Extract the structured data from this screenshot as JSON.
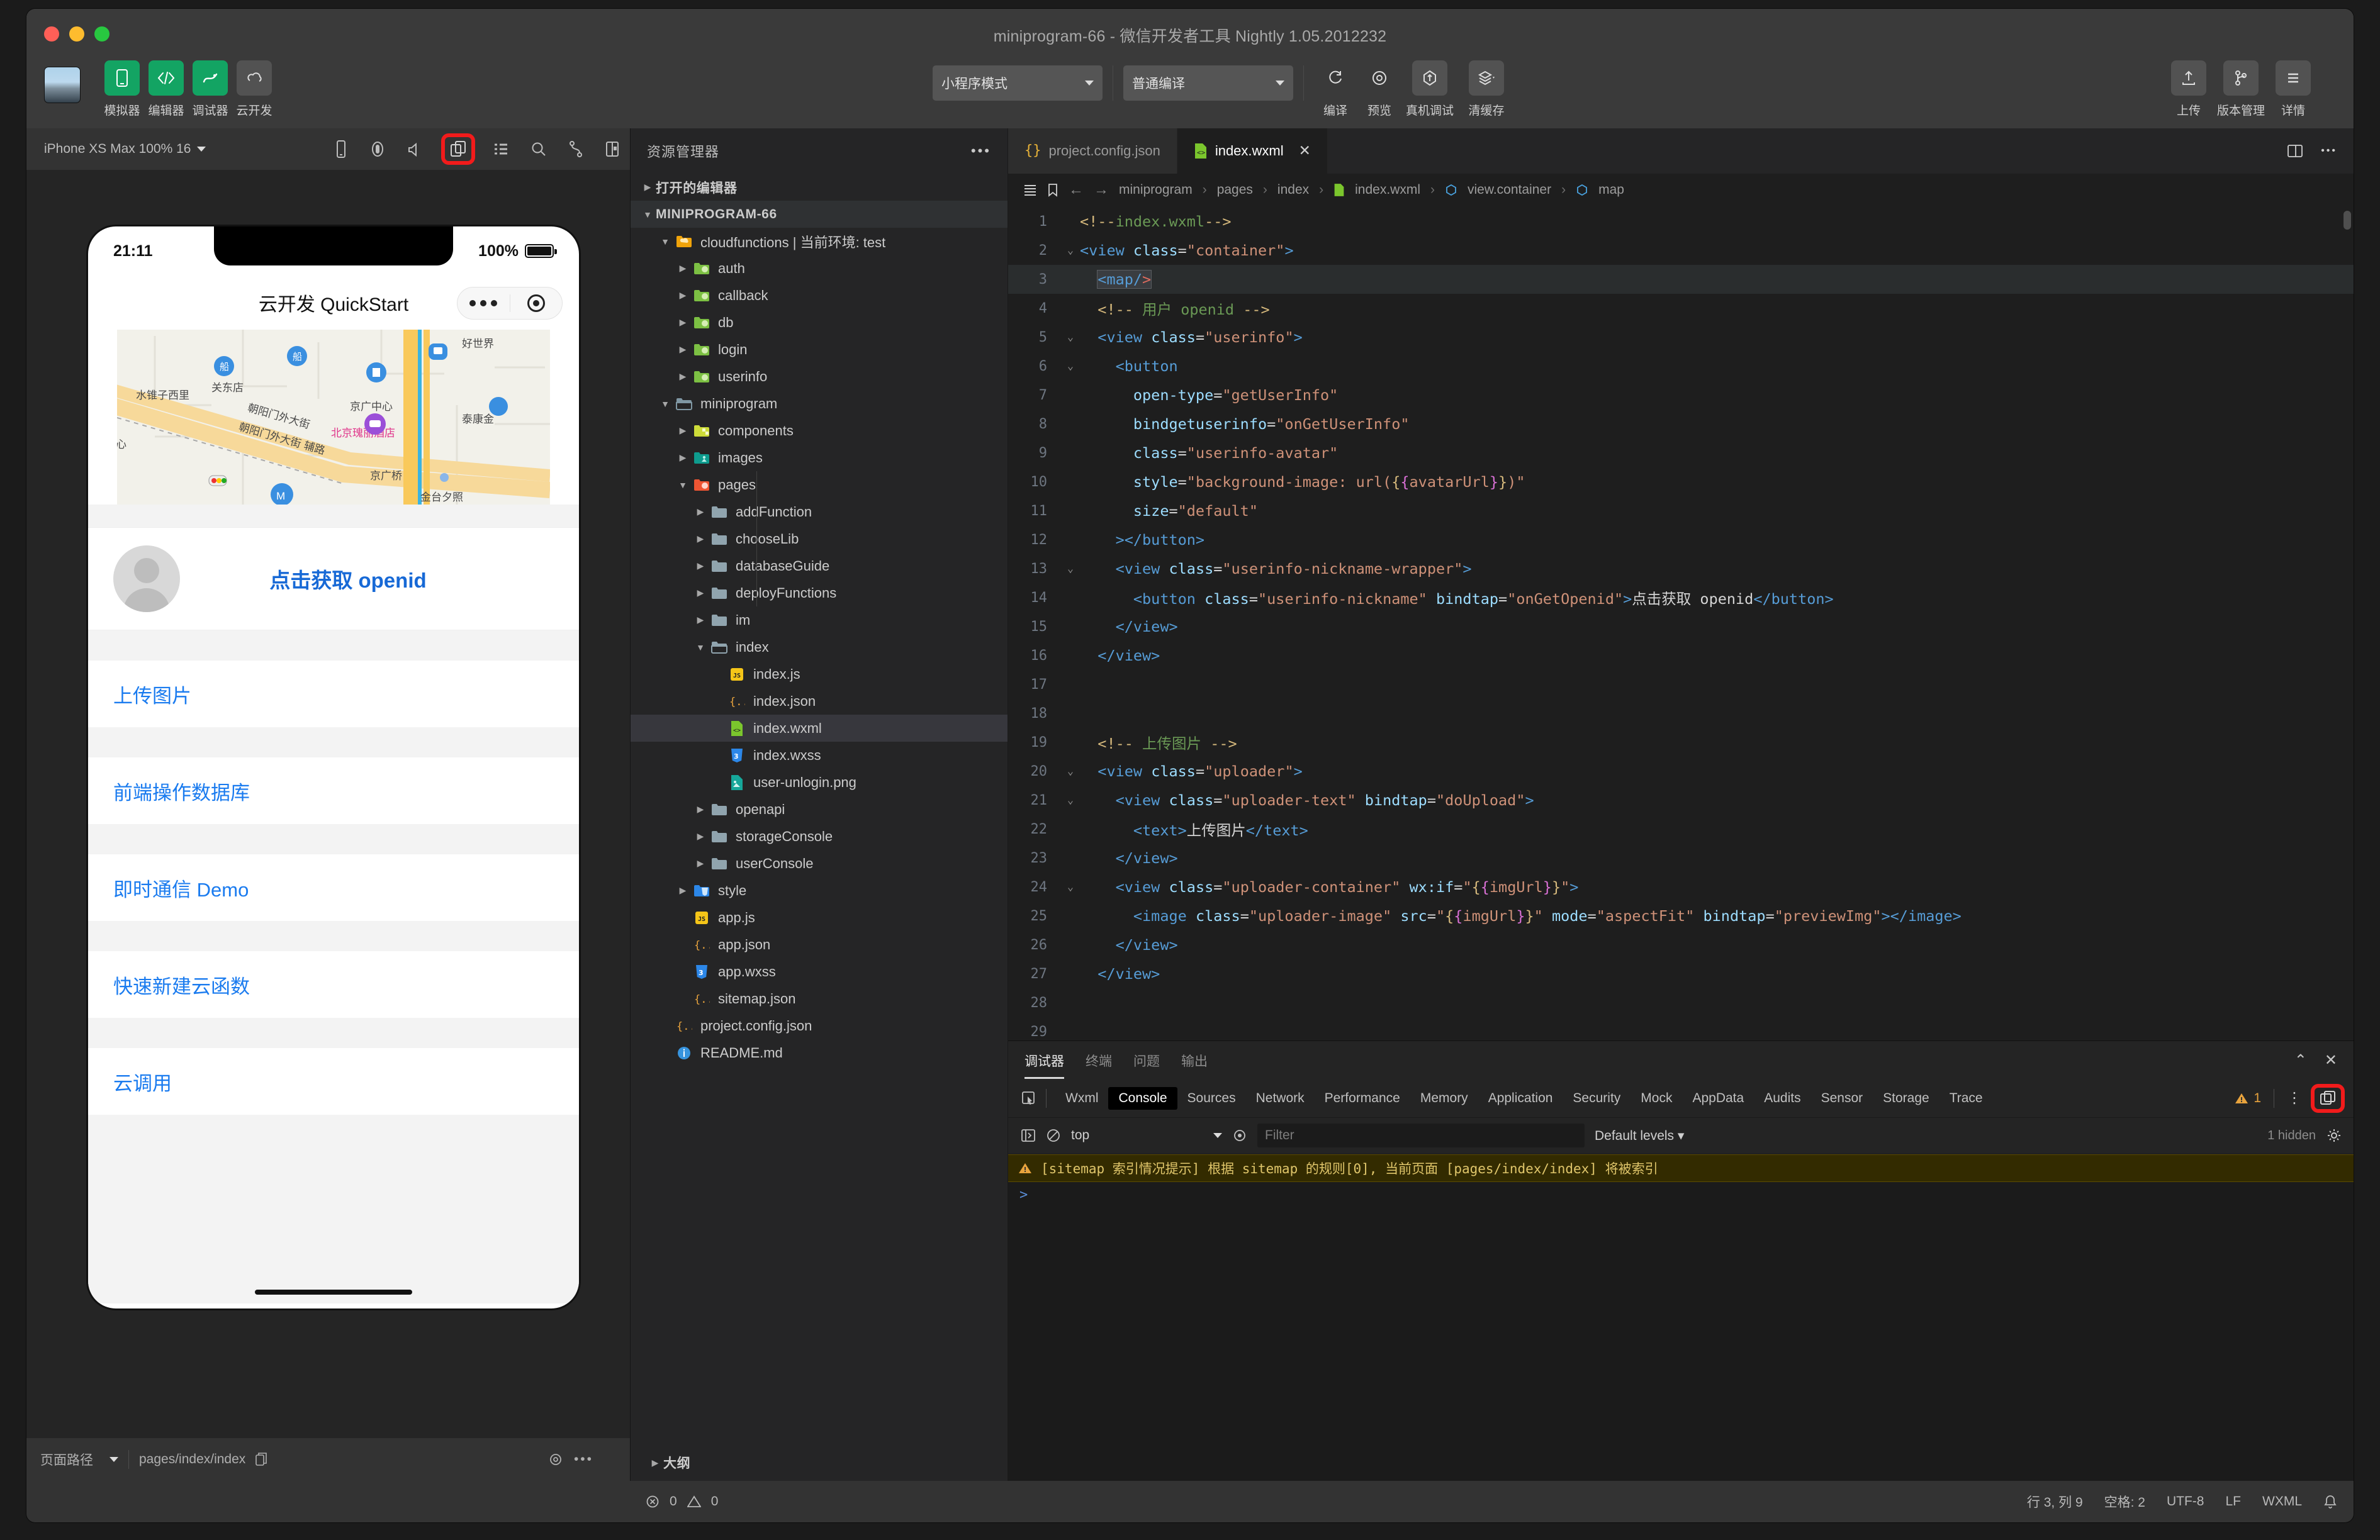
{
  "window": {
    "title": "miniprogram-66 - 微信开发者工具 Nightly 1.05.2012232"
  },
  "toolbar": {
    "items": [
      {
        "label": "模拟器",
        "icon": "phone-icon"
      },
      {
        "label": "编辑器",
        "icon": "code-icon"
      },
      {
        "label": "调试器",
        "icon": "bug-icon"
      },
      {
        "label": "云开发",
        "icon": "cloud-icon"
      }
    ],
    "mode_select": "小程序模式",
    "compile_select": "普通编译",
    "actions": [
      {
        "label": "编译",
        "icon": "refresh-icon"
      },
      {
        "label": "预览",
        "icon": "eye-icon"
      },
      {
        "label": "真机调试",
        "icon": "device-debug-icon"
      },
      {
        "label": "清缓存",
        "icon": "layers-icon"
      }
    ],
    "right_actions": [
      {
        "label": "上传",
        "icon": "upload-icon"
      },
      {
        "label": "版本管理",
        "icon": "branch-icon"
      },
      {
        "label": "详情",
        "icon": "list-icon"
      }
    ]
  },
  "simulator": {
    "device_label": "iPhone XS Max 100% 16",
    "toolbar_icons": [
      "phone-rotate-icon",
      "record-icon",
      "volume-icon",
      "multi-window-icon",
      "list-icon",
      "search-icon",
      "route-icon",
      "split-view-icon"
    ],
    "highlighted_icon_index": 3,
    "right_icon": "collapse-panel-icon",
    "phone": {
      "time": "21:11",
      "battery": "100%",
      "nav_title": "云开发 QuickStart",
      "map_labels": [
        "关东店",
        "水锥子西里",
        "京广中心",
        "朝阳门外大街",
        "朝阳门外大街 辅路",
        "北京瑰丽酒店",
        "泰康金",
        "京广桥",
        "好世界",
        "心",
        "金台夕照"
      ],
      "openid_button": "点击获取 openid",
      "cells": [
        "上传图片",
        "前端操作数据库",
        "即时通信 Demo",
        "快速新建云函数",
        "云调用"
      ]
    },
    "footer": {
      "page_path_label": "页面路径",
      "page_path": "pages/index/index"
    }
  },
  "explorer": {
    "title": "资源管理器",
    "more_icon": "ellipsis-icon",
    "open_editors": "打开的编辑器",
    "project": "MINIPROGRAM-66",
    "tree": [
      {
        "label": "cloudfunctions | 当前环境: test",
        "indent": 1,
        "kind": "folder-open-cloud",
        "arrow": "down"
      },
      {
        "label": "auth",
        "indent": 2,
        "kind": "folder-fn",
        "arrow": "right"
      },
      {
        "label": "callback",
        "indent": 2,
        "kind": "folder-fn",
        "arrow": "right"
      },
      {
        "label": "db",
        "indent": 2,
        "kind": "folder-fn",
        "arrow": "right"
      },
      {
        "label": "login",
        "indent": 2,
        "kind": "folder-fn",
        "arrow": "right"
      },
      {
        "label": "userinfo",
        "indent": 2,
        "kind": "folder-fn",
        "arrow": "right"
      },
      {
        "label": "miniprogram",
        "indent": 1,
        "kind": "folder-open",
        "arrow": "down"
      },
      {
        "label": "components",
        "indent": 2,
        "kind": "folder-comp",
        "arrow": "right"
      },
      {
        "label": "images",
        "indent": 2,
        "kind": "folder-img",
        "arrow": "right"
      },
      {
        "label": "pages",
        "indent": 2,
        "kind": "folder-pages",
        "arrow": "down"
      },
      {
        "label": "addFunction",
        "indent": 3,
        "kind": "folder",
        "arrow": "right"
      },
      {
        "label": "chooseLib",
        "indent": 3,
        "kind": "folder",
        "arrow": "right"
      },
      {
        "label": "databaseGuide",
        "indent": 3,
        "kind": "folder",
        "arrow": "right"
      },
      {
        "label": "deployFunctions",
        "indent": 3,
        "kind": "folder",
        "arrow": "right"
      },
      {
        "label": "im",
        "indent": 3,
        "kind": "folder",
        "arrow": "right"
      },
      {
        "label": "index",
        "indent": 3,
        "kind": "folder-open-plain",
        "arrow": "down"
      },
      {
        "label": "index.js",
        "indent": 4,
        "kind": "js",
        "arrow": "none"
      },
      {
        "label": "index.json",
        "indent": 4,
        "kind": "json",
        "arrow": "none"
      },
      {
        "label": "index.wxml",
        "indent": 4,
        "kind": "wxml",
        "arrow": "none",
        "selected": true
      },
      {
        "label": "index.wxss",
        "indent": 4,
        "kind": "wxss",
        "arrow": "none"
      },
      {
        "label": "user-unlogin.png",
        "indent": 4,
        "kind": "png",
        "arrow": "none"
      },
      {
        "label": "openapi",
        "indent": 3,
        "kind": "folder",
        "arrow": "right"
      },
      {
        "label": "storageConsole",
        "indent": 3,
        "kind": "folder",
        "arrow": "right"
      },
      {
        "label": "userConsole",
        "indent": 3,
        "kind": "folder",
        "arrow": "right"
      },
      {
        "label": "style",
        "indent": 2,
        "kind": "folder-style",
        "arrow": "right"
      },
      {
        "label": "app.js",
        "indent": 2,
        "kind": "js",
        "arrow": "none"
      },
      {
        "label": "app.json",
        "indent": 2,
        "kind": "json",
        "arrow": "none"
      },
      {
        "label": "app.wxss",
        "indent": 2,
        "kind": "wxss",
        "arrow": "none"
      },
      {
        "label": "sitemap.json",
        "indent": 2,
        "kind": "json",
        "arrow": "none"
      },
      {
        "label": "project.config.json",
        "indent": 1,
        "kind": "json",
        "arrow": "none"
      },
      {
        "label": "README.md",
        "indent": 1,
        "kind": "md",
        "arrow": "none"
      }
    ],
    "outline": "大纲",
    "problems": {
      "errors": "0",
      "warnings": "0"
    }
  },
  "editor": {
    "tabs": [
      {
        "label": "project.config.json",
        "icon": "json-icon",
        "active": false
      },
      {
        "label": "index.wxml",
        "icon": "wxml-icon",
        "active": true,
        "close": "✕"
      }
    ],
    "tab_actions": [
      "split-editor-icon",
      "ellipsis-icon"
    ],
    "breadcrumb": [
      "miniprogram",
      "pages",
      "index",
      "index.wxml",
      "view.container",
      "map"
    ],
    "breadcrumb_icons": [
      "outline-icon",
      "bookmark-icon",
      "arrow-left-icon",
      "arrow-right-icon"
    ],
    "lines": [
      {
        "n": "1",
        "fold": "",
        "html": "<span class='k-cmtp'>&lt;!--</span><span class='k-cmt'>index.wxml</span><span class='k-cmtp'>--&gt;</span>"
      },
      {
        "n": "2",
        "fold": "v",
        "html": "<span class='k-tag'>&lt;view</span> <span class='k-attr'>class</span><span class='k-txt'>=</span><span class='k-str'>\"container\"</span><span class='k-tag'>&gt;</span>"
      },
      {
        "n": "3",
        "fold": "",
        "hl": true,
        "html": "  <span class='selbox'><span class='k-tag'>&lt;map/</span><span class='k-red'>&gt;</span></span>"
      },
      {
        "n": "4",
        "fold": "",
        "html": "  <span class='k-cmtp'>&lt;!--</span> <span class='k-cmt'>用户 openid</span> <span class='k-cmtp'>--&gt;</span>"
      },
      {
        "n": "5",
        "fold": "v",
        "html": "  <span class='k-tag'>&lt;view</span> <span class='k-attr'>class</span><span class='k-txt'>=</span><span class='k-str'>\"userinfo\"</span><span class='k-tag'>&gt;</span>"
      },
      {
        "n": "6",
        "fold": "v",
        "html": "    <span class='k-tag'>&lt;button</span>"
      },
      {
        "n": "7",
        "fold": "",
        "html": "      <span class='k-attr'>open-type</span><span class='k-txt'>=</span><span class='k-str'>\"getUserInfo\"</span>"
      },
      {
        "n": "8",
        "fold": "",
        "html": "      <span class='k-attr'>bindgetuserinfo</span><span class='k-txt'>=</span><span class='k-str'>\"onGetUserInfo\"</span>"
      },
      {
        "n": "9",
        "fold": "",
        "html": "      <span class='k-attr'>class</span><span class='k-txt'>=</span><span class='k-str'>\"userinfo-avatar\"</span>"
      },
      {
        "n": "10",
        "fold": "",
        "html": "      <span class='k-attr'>style</span><span class='k-txt'>=</span><span class='k-str'>\"background-image: url(</span><span class='k-br'>{</span><span class='k-br2'>{</span><span class='k-str'>avatarUrl</span><span class='k-br2'>}</span><span class='k-br'>}</span><span class='k-str'>)\"</span>"
      },
      {
        "n": "11",
        "fold": "",
        "html": "      <span class='k-attr'>size</span><span class='k-txt'>=</span><span class='k-str'>\"default\"</span>"
      },
      {
        "n": "12",
        "fold": "",
        "html": "    <span class='k-tag'>&gt;&lt;/button&gt;</span>"
      },
      {
        "n": "13",
        "fold": "v",
        "html": "    <span class='k-tag'>&lt;view</span> <span class='k-attr'>class</span><span class='k-txt'>=</span><span class='k-str'>\"userinfo-nickname-wrapper\"</span><span class='k-tag'>&gt;</span>"
      },
      {
        "n": "14",
        "fold": "",
        "html": "      <span class='k-tag'>&lt;button</span> <span class='k-attr'>class</span><span class='k-txt'>=</span><span class='k-str'>\"userinfo-nickname\"</span> <span class='k-attr'>bindtap</span><span class='k-txt'>=</span><span class='k-str'>\"onGetOpenid\"</span><span class='k-tag'>&gt;</span><span class='k-txt'>点击获取 openid</span><span class='k-tag'>&lt;/button&gt;</span>"
      },
      {
        "n": "15",
        "fold": "",
        "html": "    <span class='k-tag'>&lt;/view&gt;</span>"
      },
      {
        "n": "16",
        "fold": "",
        "html": "  <span class='k-tag'>&lt;/view&gt;</span>"
      },
      {
        "n": "17",
        "fold": "",
        "html": ""
      },
      {
        "n": "18",
        "fold": "",
        "html": ""
      },
      {
        "n": "19",
        "fold": "",
        "html": "  <span class='k-cmtp'>&lt;!--</span> <span class='k-cmt'>上传图片</span> <span class='k-cmtp'>--&gt;</span>"
      },
      {
        "n": "20",
        "fold": "v",
        "html": "  <span class='k-tag'>&lt;view</span> <span class='k-attr'>class</span><span class='k-txt'>=</span><span class='k-str'>\"uploader\"</span><span class='k-tag'>&gt;</span>"
      },
      {
        "n": "21",
        "fold": "v",
        "html": "    <span class='k-tag'>&lt;view</span> <span class='k-attr'>class</span><span class='k-txt'>=</span><span class='k-str'>\"uploader-text\"</span> <span class='k-attr'>bindtap</span><span class='k-txt'>=</span><span class='k-str'>\"doUpload\"</span><span class='k-tag'>&gt;</span>"
      },
      {
        "n": "22",
        "fold": "",
        "html": "      <span class='k-tag'>&lt;text&gt;</span><span class='k-txt'>上传图片</span><span class='k-tag'>&lt;/text&gt;</span>"
      },
      {
        "n": "23",
        "fold": "",
        "html": "    <span class='k-tag'>&lt;/view&gt;</span>"
      },
      {
        "n": "24",
        "fold": "v",
        "html": "    <span class='k-tag'>&lt;view</span> <span class='k-attr'>class</span><span class='k-txt'>=</span><span class='k-str'>\"uploader-container\"</span> <span class='k-attr'>wx:if</span><span class='k-txt'>=</span><span class='k-str'>\"</span><span class='k-br'>{</span><span class='k-br2'>{</span><span class='k-str'>imgUrl</span><span class='k-br2'>}</span><span class='k-br'>}</span><span class='k-str'>\"</span><span class='k-tag'>&gt;</span>"
      },
      {
        "n": "25",
        "fold": "",
        "html": "      <span class='k-tag'>&lt;image</span> <span class='k-attr'>class</span><span class='k-txt'>=</span><span class='k-str'>\"uploader-image\"</span> <span class='k-attr'>src</span><span class='k-txt'>=</span><span class='k-str'>\"</span><span class='k-br'>{</span><span class='k-br2'>{</span><span class='k-str'>imgUrl</span><span class='k-br2'>}</span><span class='k-br'>}</span><span class='k-str'>\"</span> <span class='k-attr'>mode</span><span class='k-txt'>=</span><span class='k-str'>\"aspectFit\"</span> <span class='k-attr'>bindtap</span><span class='k-txt'>=</span><span class='k-str'>\"previewImg\"</span><span class='k-tag'>&gt;&lt;/image&gt;</span>"
      },
      {
        "n": "26",
        "fold": "",
        "html": "    <span class='k-tag'>&lt;/view&gt;</span>"
      },
      {
        "n": "27",
        "fold": "",
        "html": "  <span class='k-tag'>&lt;/view&gt;</span>"
      },
      {
        "n": "28",
        "fold": "",
        "html": ""
      },
      {
        "n": "29",
        "fold": "",
        "html": ""
      }
    ]
  },
  "devtools": {
    "panel_tabs": [
      {
        "label": "调试器",
        "active": true
      },
      {
        "label": "终端",
        "active": false
      },
      {
        "label": "问题",
        "active": false
      },
      {
        "label": "输出",
        "active": false
      }
    ],
    "panel_actions": [
      "chevron-up-icon",
      "close-icon"
    ],
    "inspect_icon": "inspect-element-icon",
    "tabs": [
      {
        "label": "Wxml",
        "sel": false
      },
      {
        "label": "Console",
        "sel": true
      },
      {
        "label": "Sources",
        "sel": false
      },
      {
        "label": "Network",
        "sel": false
      },
      {
        "label": "Performance",
        "sel": false
      },
      {
        "label": "Memory",
        "sel": false
      },
      {
        "label": "Application",
        "sel": false
      },
      {
        "label": "Security",
        "sel": false
      },
      {
        "label": "Mock",
        "sel": false
      },
      {
        "label": "AppData",
        "sel": false
      },
      {
        "label": "Audits",
        "sel": false
      },
      {
        "label": "Sensor",
        "sel": false
      },
      {
        "label": "Storage",
        "sel": false
      },
      {
        "label": "Trace",
        "sel": false
      }
    ],
    "warning_count": "1",
    "more_icon": "kebab-icon",
    "dock_icon": "dock-panel-icon",
    "console": {
      "context": "top",
      "filter_placeholder": "Filter",
      "levels": "Default levels",
      "hidden_note": "1 hidden",
      "settings_icon": "gear-icon",
      "message": "[sitemap 索引情况提示] 根据 sitemap 的规则[0], 当前页面 [pages/index/index] 将被索引",
      "prompt": ">"
    }
  },
  "statusbar": {
    "cursor": "行 3, 列 9",
    "indent": "空格: 2",
    "encoding": "UTF-8",
    "eol": "LF",
    "language": "WXML",
    "bell_icon": "bell-icon"
  }
}
